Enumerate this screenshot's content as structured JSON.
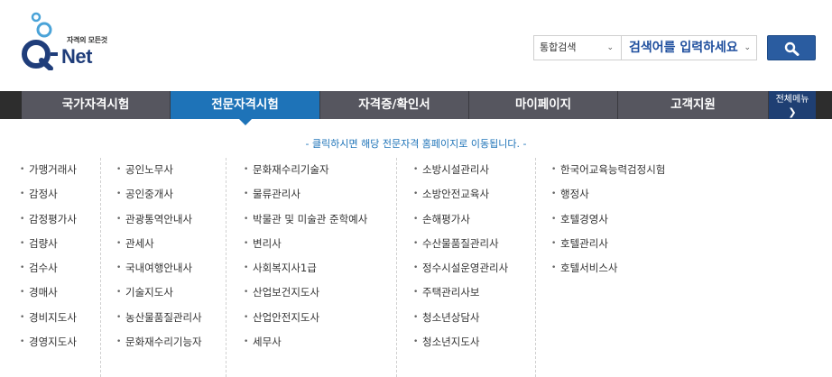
{
  "header": {
    "logo_slogan": "자격의 모든것",
    "logo_brand": "Net",
    "logo_icon": "q-net-logo-icon"
  },
  "search": {
    "scope_value": "통합검색",
    "keyword_placeholder": "검색어를 입력하세요",
    "button_icon": "search-icon"
  },
  "nav": {
    "items": [
      "국가자격시험",
      "전문자격시험",
      "자격증/확인서",
      "마이페이지",
      "고객지원"
    ],
    "active_index": 1,
    "all_menu_label": "전체메뉴",
    "all_menu_icon": "chevron-down-icon"
  },
  "notice": "- 클릭하시면 해당 전문자격 홈페이지로 이동됩니다. -",
  "columns": [
    [
      "가맹거래사",
      "감정사",
      "감정평가사",
      "검량사",
      "검수사",
      "경매사",
      "경비지도사",
      "경영지도사"
    ],
    [
      "공인노무사",
      "공인중개사",
      "관광통역안내사",
      "관세사",
      "국내여행안내사",
      "기술지도사",
      "농산물품질관리사",
      "문화재수리기능자"
    ],
    [
      "문화재수리기술자",
      "물류관리사",
      "박물관 및 미술관 준학예사",
      "변리사",
      "사회복지사1급",
      "산업보건지도사",
      "산업안전지도사",
      "세무사"
    ],
    [
      "소방시설관리사",
      "소방안전교육사",
      "손해평가사",
      "수산물품질관리사",
      "정수시설운영관리사",
      "주택관리사보",
      "청소년상담사",
      "청소년지도사"
    ],
    [
      "한국어교육능력검정시험",
      "행정사",
      "호텔경영사",
      "호텔관리사",
      "호텔서비스사"
    ]
  ],
  "colors": {
    "nav_bg": "#56565f",
    "nav_active": "#1e73b8",
    "all_menu_bg": "#1f3f73",
    "search_btn": "#2a5ca0",
    "notice_text": "#1e73b8"
  }
}
